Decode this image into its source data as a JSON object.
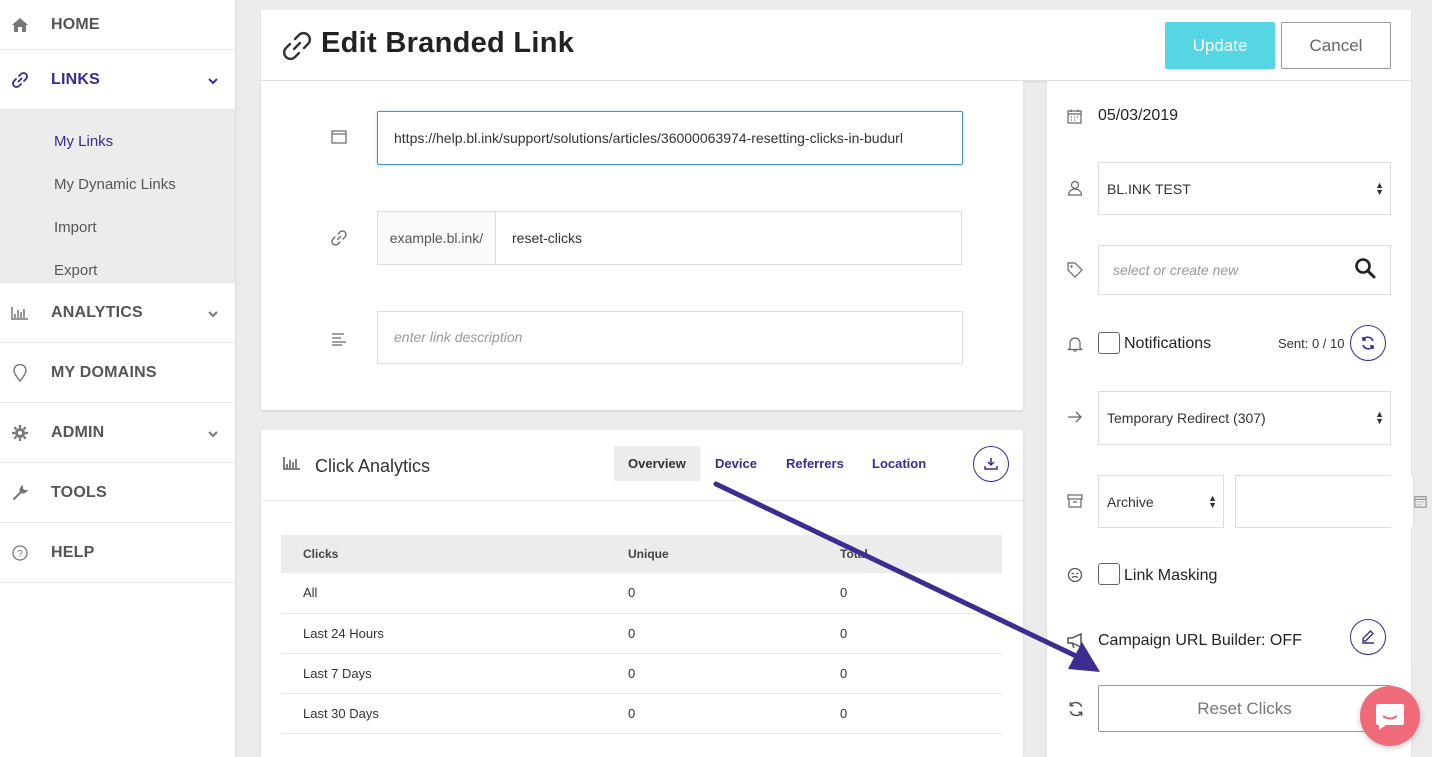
{
  "sidebar": {
    "home": "HOME",
    "links": "LINKS",
    "links_sub": [
      "My Links",
      "My Dynamic Links",
      "Import",
      "Export"
    ],
    "analytics": "ANALYTICS",
    "my_domains": "MY DOMAINS",
    "admin": "ADMIN",
    "tools": "TOOLS",
    "help": "HELP"
  },
  "header": {
    "title": "Edit Branded Link",
    "update_label": "Update",
    "cancel_label": "Cancel"
  },
  "form": {
    "url_value": "https://help.bl.ink/support/solutions/articles/36000063974-resetting-clicks-in-budurl",
    "domain_prefix": "example.bl.ink/",
    "alias_value": "reset-clicks",
    "description_placeholder": "enter link description"
  },
  "analytics": {
    "title": "Click Analytics",
    "tabs": [
      "Overview",
      "Device",
      "Referrers",
      "Location"
    ],
    "columns": [
      "Clicks",
      "Unique",
      "Total"
    ],
    "rows": [
      [
        "All",
        "0",
        "0"
      ],
      [
        "Last 24 Hours",
        "0",
        "0"
      ],
      [
        "Last 7 Days",
        "0",
        "0"
      ],
      [
        "Last 30 Days",
        "0",
        "0"
      ]
    ]
  },
  "right_panel": {
    "date": "05/03/2019",
    "owner": "BL.INK TEST",
    "tag_placeholder": "select or create new",
    "notifications_label": "Notifications",
    "sent_text": "Sent: 0 / 10",
    "redirect": "Temporary Redirect (307)",
    "archive": "Archive",
    "link_masking_label": "Link Masking",
    "campaign_label": "Campaign URL Builder: OFF",
    "reset_label": "Reset Clicks"
  },
  "colors": {
    "accent": "#3c2a8c",
    "update_button": "#55d6e2",
    "chat_bubble": "#ef6b7a",
    "annotation_arrow": "#3f2c90"
  },
  "icons": [
    "home-icon",
    "link-icon",
    "bar-chart-icon",
    "map-pin-icon",
    "gear-icon",
    "wrench-icon",
    "help-icon",
    "browser-icon",
    "text-lines-icon",
    "download-icon",
    "calendar-icon",
    "user-icon",
    "tag-icon",
    "search-icon",
    "bell-icon",
    "refresh-icon",
    "arrow-right-icon",
    "archive-icon",
    "mask-icon",
    "megaphone-icon",
    "edit-icon",
    "chat-icon"
  ]
}
